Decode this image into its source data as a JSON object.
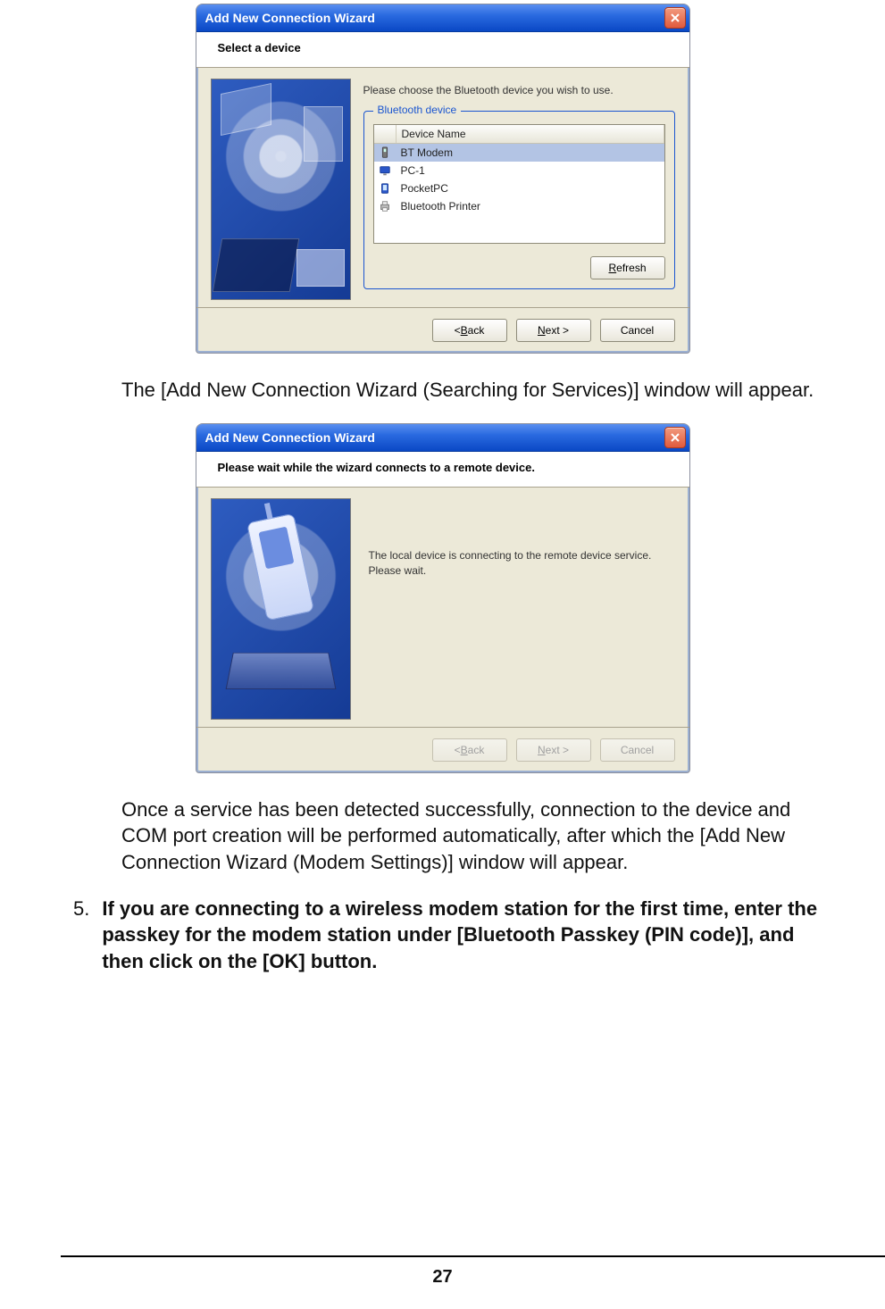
{
  "dialog1": {
    "title": "Add New Connection Wizard",
    "subtitle": "Select a device",
    "instruction": "Please choose the Bluetooth device you wish to use.",
    "groupbox_label": "Bluetooth device",
    "column_header": "Device Name",
    "devices": [
      {
        "icon": "phone-icon",
        "name": "BT Modem",
        "selected": true
      },
      {
        "icon": "monitor-icon",
        "name": "PC-1",
        "selected": false
      },
      {
        "icon": "pda-icon",
        "name": "PocketPC",
        "selected": false
      },
      {
        "icon": "printer-icon",
        "name": "Bluetooth Printer",
        "selected": false
      }
    ],
    "refresh_label_pre": "",
    "refresh_mnem": "R",
    "refresh_label_post": "efresh",
    "back_label": "< ",
    "back_mnem": "B",
    "back_post": "ack",
    "next_mnem": "N",
    "next_post": "ext >",
    "cancel_label": "Cancel"
  },
  "para1": "The [Add New Connection Wizard (Searching for Services)] window will appear.",
  "dialog2": {
    "title": "Add New Connection Wizard",
    "subtitle": "Please wait while the wizard connects to a remote device.",
    "connect_line1": "The local device is connecting to the remote device service.",
    "connect_line2": "Please wait.",
    "back_label": "< ",
    "back_mnem": "B",
    "back_post": "ack",
    "next_mnem": "N",
    "next_post": "ext >",
    "cancel_label": "Cancel"
  },
  "para2": "Once a service has been detected successfully, connection to the device and COM port creation will be performed automatically, after which the [Add New Connection Wizard (Modem Settings)] window will appear.",
  "step5": {
    "num": "5.",
    "text": "If you are connecting to a wireless modem station for the first time, enter the passkey for the modem station under [Bluetooth Passkey (PIN code)], and then click on the [OK] button."
  },
  "page_number": "27"
}
